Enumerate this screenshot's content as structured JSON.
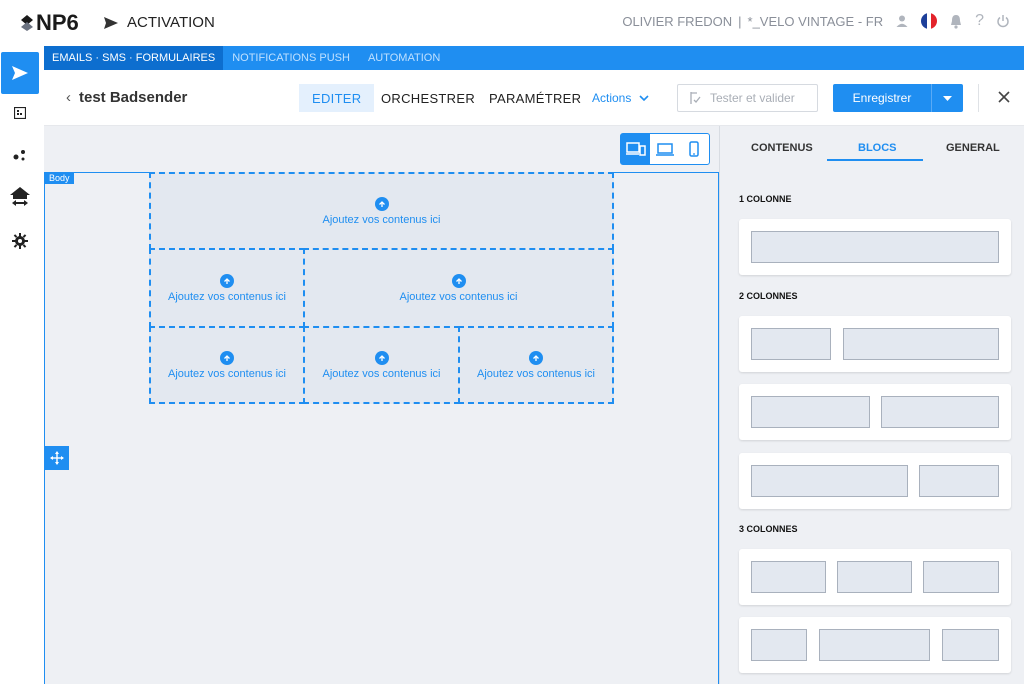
{
  "brand": {
    "logo_text": "NP6",
    "app_title": "ACTIVATION"
  },
  "user": {
    "name": "OLIVIER FREDON",
    "separator": "|",
    "account": "*_VELO VINTAGE - FR"
  },
  "subnav": [
    "EMAILS · SMS · FORMULAIRES",
    "NOTIFICATIONS PUSH",
    "AUTOMATION"
  ],
  "toolbar": {
    "back_label": "test Badsender",
    "tabs": [
      "EDITER",
      "ORCHESTRER",
      "PARAMÉTRER"
    ],
    "actions_label": "Actions",
    "test_label": "Tester et valider",
    "save_label": "Enregistrer"
  },
  "canvas": {
    "body_tag": "Body",
    "cell_text": "Ajoutez vos contenus ici"
  },
  "panel": {
    "tabs": [
      "CONTENUS",
      "BLOCS",
      "GENERAL"
    ],
    "active_tab": "BLOCS",
    "sections": [
      "1 COLONNE",
      "2 COLONNES",
      "3 COLONNES"
    ]
  },
  "colors": {
    "accent": "#1f8ef1",
    "canvas_bg": "#eef0f4",
    "cell_bg": "#e3e8f0"
  }
}
